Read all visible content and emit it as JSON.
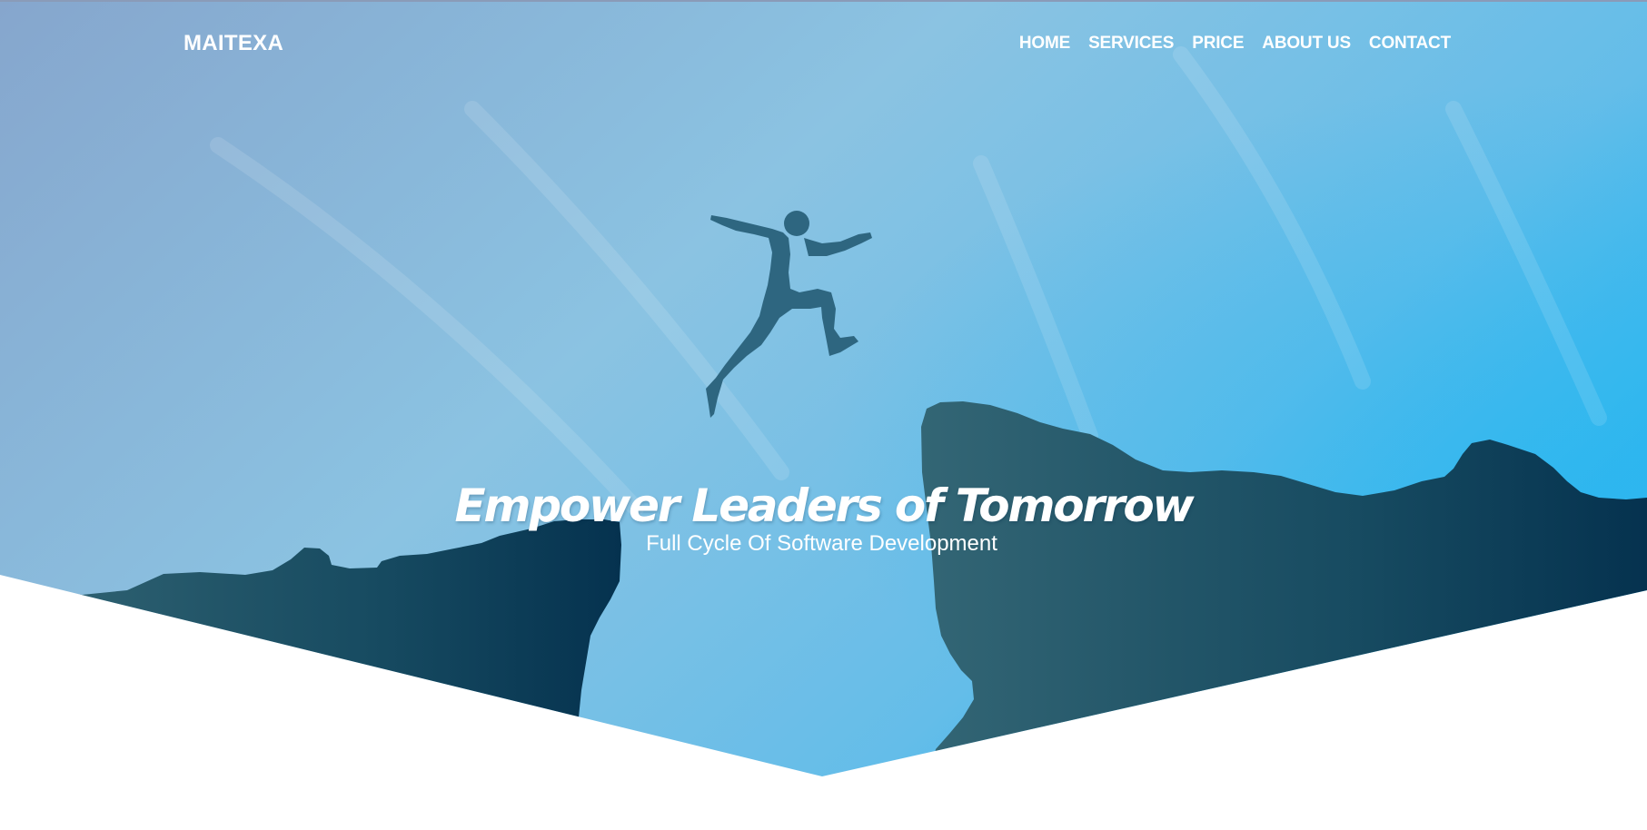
{
  "brand": {
    "name": "MAITEXA"
  },
  "nav": {
    "items": [
      {
        "label": "HOME"
      },
      {
        "label": "SERVICES"
      },
      {
        "label": "PRICE"
      },
      {
        "label": "ABOUT US"
      },
      {
        "label": "CONTACT"
      }
    ]
  },
  "hero": {
    "title": "Empower Leaders of Tomorrow",
    "subtitle": "Full Cycle Of Software Development"
  },
  "colors": {
    "sky_top_left": "#86a6cd",
    "sky_right": "#2fb6ee",
    "cliff_left": "#2f6071",
    "cliff_right": "#05324f",
    "text": "#ffffff",
    "page_background": "#ffffff"
  },
  "icons": {
    "hero_image": "person-jumping-between-cliffs-image"
  }
}
